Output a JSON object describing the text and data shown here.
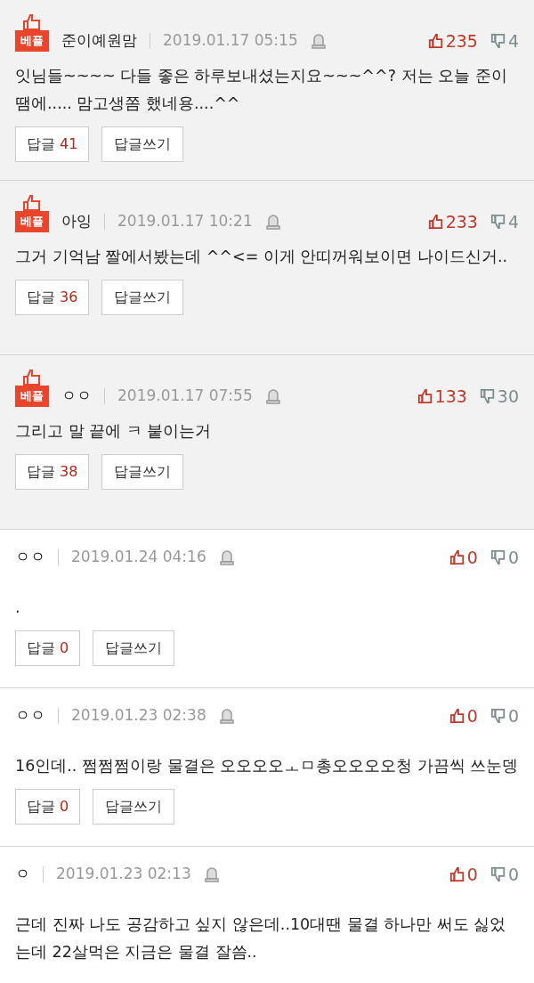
{
  "comments": [
    {
      "best": true,
      "badge": "베플",
      "author": "준이예원맘",
      "date": "2019.01.17 05:15",
      "likes": "235",
      "dislikes": "4",
      "text": "잇님들~~~~ 다들 좋은 하루보내셨는지요~~~^^? 저는 오늘 준이 땜에..... 맘고생쫌 했네용....^^",
      "reply_label": "답글",
      "reply_count": "41",
      "write_label": "답글쓰기"
    },
    {
      "best": true,
      "badge": "베플",
      "author": "아잉",
      "date": "2019.01.17 10:21",
      "likes": "233",
      "dislikes": "4",
      "text": "그거 기억남 짤에서봤는데 ^^<= 이게 안띠꺼워보이면 나이드신거..",
      "reply_label": "답글",
      "reply_count": "36",
      "write_label": "답글쓰기"
    },
    {
      "best": true,
      "badge": "베플",
      "author": "ㅇㅇ",
      "date": "2019.01.17 07:55",
      "likes": "133",
      "dislikes": "30",
      "text": "그리고 말 끝에 ㅋ 붙이는거",
      "reply_label": "답글",
      "reply_count": "38",
      "write_label": "답글쓰기"
    },
    {
      "best": false,
      "author": "ㅇㅇ",
      "date": "2019.01.24 04:16",
      "likes": "0",
      "dislikes": "0",
      "text": ".",
      "reply_label": "답글",
      "reply_count": "0",
      "write_label": "답글쓰기"
    },
    {
      "best": false,
      "author": "ㅇㅇ",
      "date": "2019.01.23 02:38",
      "likes": "0",
      "dislikes": "0",
      "text": "16인데.. 쩜쩜쩜이랑 물결은 오오오오ㅗㅁ총오오오오청 가끔씩 쓰눈뎅",
      "reply_label": "답글",
      "reply_count": "0",
      "write_label": "답글쓰기"
    },
    {
      "best": false,
      "author": "ㅇ",
      "date": "2019.01.23 02:13",
      "likes": "0",
      "dislikes": "0",
      "text": "근데 진짜 나도 공감하고 싶지 않은데..10대땐 물결 하나만 써도 싫었는데 22살먹은 지금은 물결 잘씀.."
    }
  ]
}
